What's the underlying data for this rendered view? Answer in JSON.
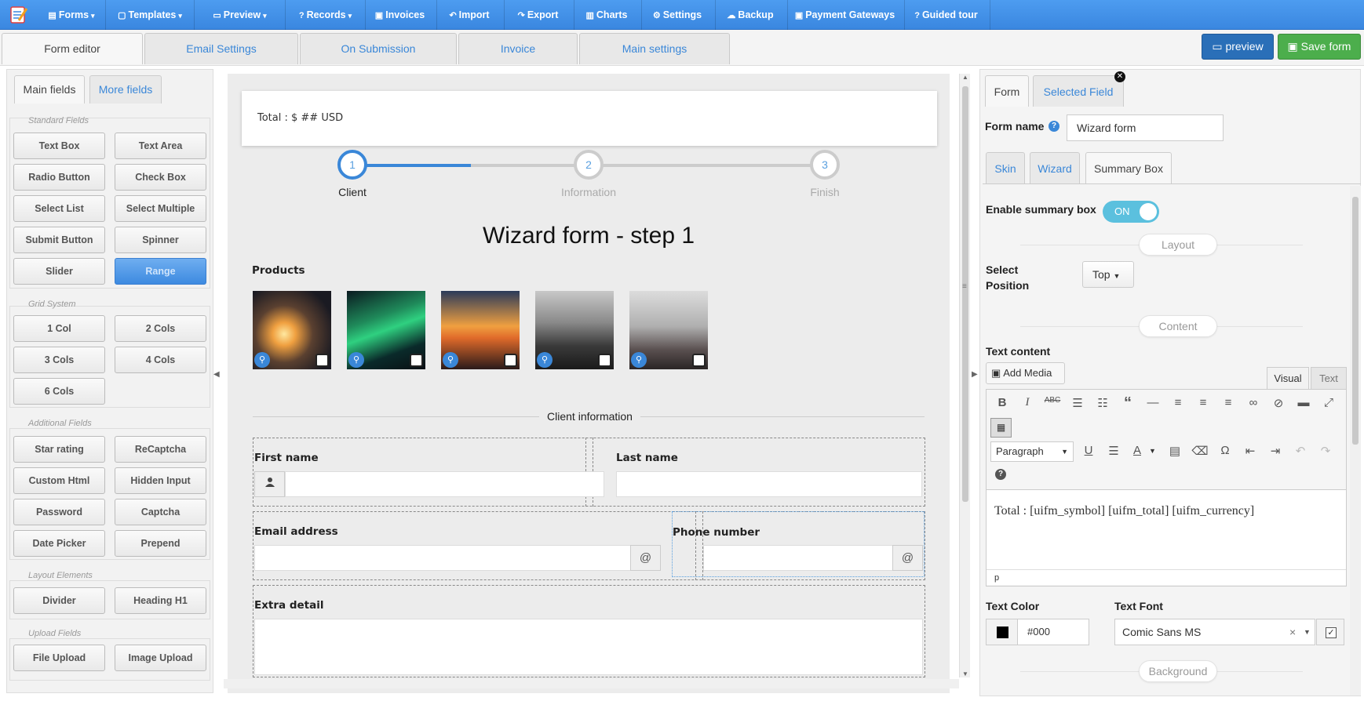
{
  "nav": {
    "items": [
      {
        "icon": "▤",
        "label": "Forms",
        "caret": "▾"
      },
      {
        "icon": "▢",
        "label": "Templates",
        "caret": "▾"
      },
      {
        "icon": "▭",
        "label": "Preview",
        "caret": "▾"
      },
      {
        "icon": "?",
        "label": "Records",
        "caret": "▾"
      },
      {
        "icon": "▣",
        "label": "Invoices",
        "caret": ""
      },
      {
        "icon": "↶",
        "label": "Import",
        "caret": ""
      },
      {
        "icon": "↷",
        "label": "Export",
        "caret": ""
      },
      {
        "icon": "▥",
        "label": "Charts",
        "caret": ""
      },
      {
        "icon": "⚙",
        "label": "Settings",
        "caret": ""
      },
      {
        "icon": "☁",
        "label": "Backup",
        "caret": ""
      },
      {
        "icon": "▣",
        "label": "Payment Gateways",
        "caret": ""
      },
      {
        "icon": "?",
        "label": "Guided tour",
        "caret": ""
      }
    ]
  },
  "form_tabs": [
    "Form editor",
    "Email Settings",
    "On Submission",
    "Invoice",
    "Main settings"
  ],
  "toolbar": {
    "preview_label": "preview",
    "save_label": "Save form",
    "preview_color": "#2a6fb8",
    "save_color": "#4cae4c"
  },
  "left": {
    "tabs": [
      "Main fields",
      "More fields"
    ],
    "standard_title": "Standard Fields",
    "standard": [
      "Text Box",
      "Text Area",
      "Radio Button",
      "Check Box",
      "Select List",
      "Select Multiple",
      "Submit Button",
      "Spinner",
      "Slider",
      "Range"
    ],
    "grid_title": "Grid System",
    "grid": [
      "1 Col",
      "2 Cols",
      "3 Cols",
      "4 Cols",
      "6 Cols"
    ],
    "additional_title": "Additional Fields",
    "additional": [
      "Star rating",
      "ReCaptcha",
      "Custom Html",
      "Hidden Input",
      "Password",
      "Captcha",
      "Date Picker",
      "Prepend"
    ],
    "layout_title": "Layout Elements",
    "layout": [
      "Divider",
      "Heading H1"
    ],
    "upload_title": "Upload Fields",
    "upload": [
      "File Upload",
      "Image Upload"
    ]
  },
  "canvas": {
    "summary_text": "Total : $ ## USD",
    "steps": [
      {
        "num": "1",
        "label": "Client"
      },
      {
        "num": "2",
        "label": "Information"
      },
      {
        "num": "3",
        "label": "Finish"
      }
    ],
    "step_progress": 0.25,
    "heading": "Wizard form - step 1",
    "products_label": "Products",
    "products_count": 5,
    "divider_label": "Client information",
    "first_name_label": "First name",
    "last_name_label": "Last name",
    "email_label": "Email address",
    "phone_label": "Phone number",
    "extra_label": "Extra detail",
    "at_symbol": "@"
  },
  "right": {
    "tabs": [
      "Form",
      "Selected Field"
    ],
    "form_name_label": "Form name",
    "form_name_value": "Wizard form",
    "subtabs": [
      "Skin",
      "Wizard",
      "Summary Box"
    ],
    "enable_label": "Enable summary box",
    "toggle_text": "ON",
    "layout_pill": "Layout",
    "position_label": "Select Position",
    "position_value": "Top",
    "content_pill": "Content",
    "text_content_label": "Text content",
    "add_media": "Add Media",
    "visual_tab": "Visual",
    "text_tab": "Text",
    "paragraph": "Paragraph",
    "editor_text": "Total : [uifm_symbol] [uifm_total] [uifm_currency]",
    "path": "p",
    "text_color_label": "Text Color",
    "text_color_value": "#000",
    "text_font_label": "Text Font",
    "text_font_value": "Comic Sans MS",
    "background_pill": "Background"
  }
}
